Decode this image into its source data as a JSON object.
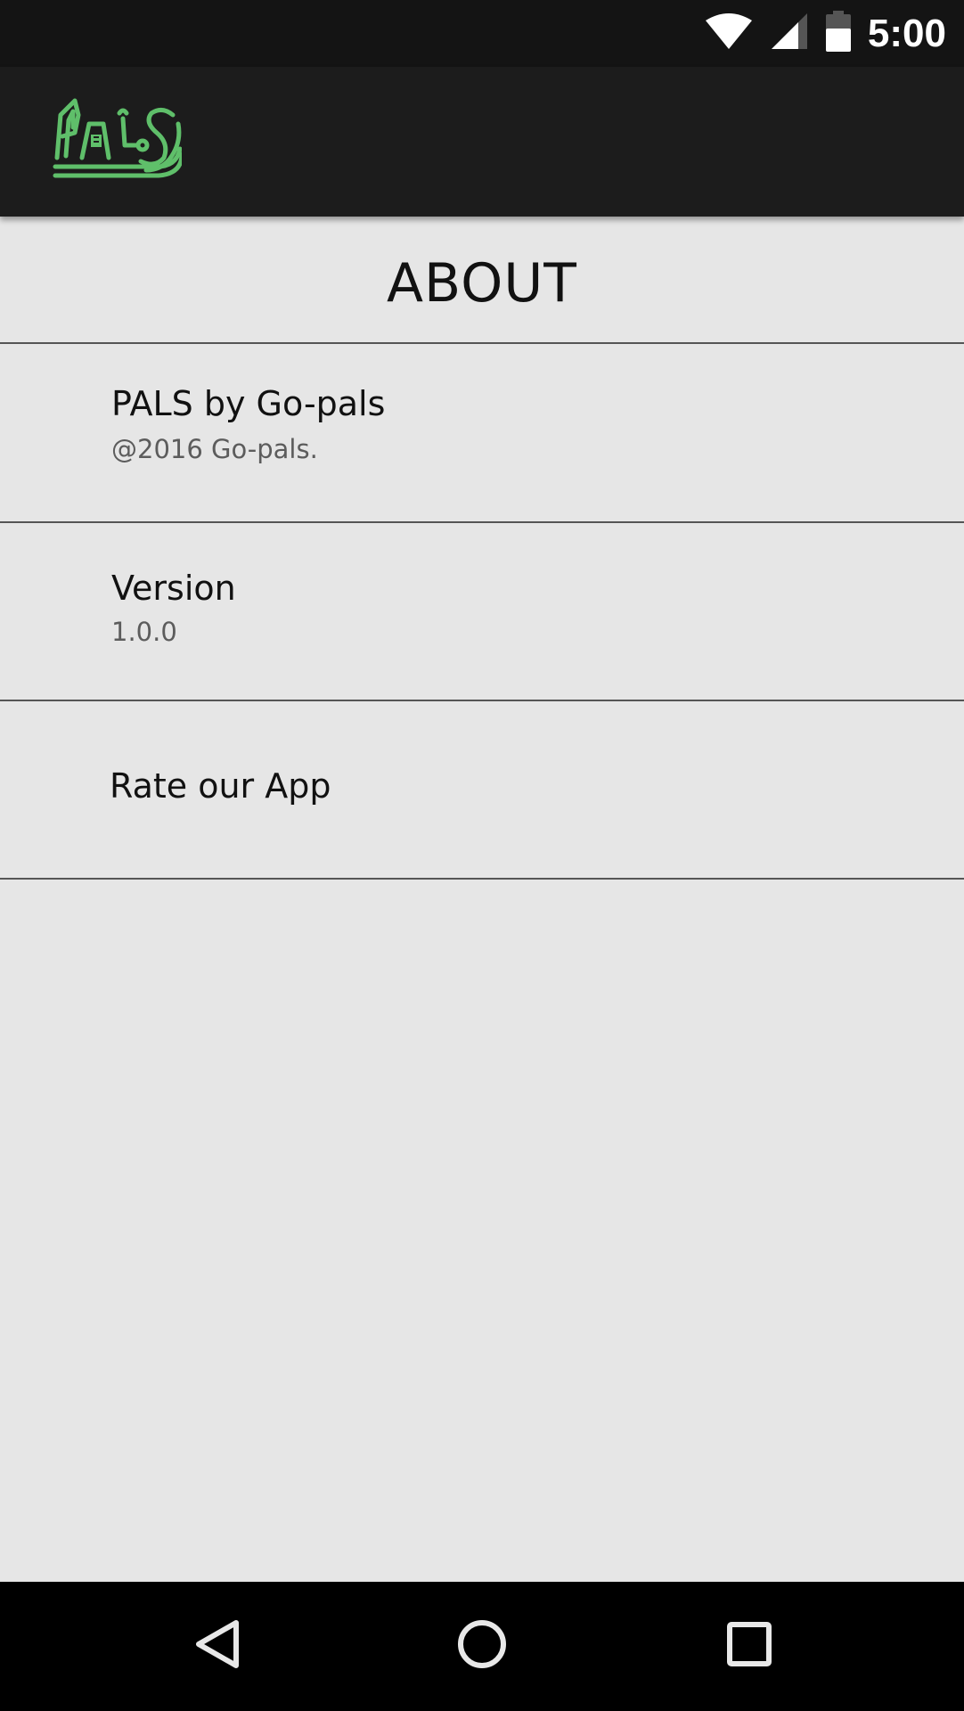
{
  "status_bar": {
    "time": "5:00",
    "icons": [
      "wifi-icon",
      "cellular-signal-icon",
      "battery-icon"
    ]
  },
  "app_bar": {
    "logo_text": "PALS",
    "logo_color": "#5fbf6a"
  },
  "page": {
    "title": "ABOUT"
  },
  "rows": [
    {
      "title": "PALS by Go-pals",
      "subtitle": "@2016 Go-pals."
    },
    {
      "title": "Version",
      "subtitle": "1.0.0"
    },
    {
      "title": "Rate our App"
    }
  ],
  "nav_bar": {
    "icons": [
      "back-icon",
      "home-icon",
      "recents-icon"
    ]
  },
  "colors": {
    "status_bar_bg": "#141414",
    "app_bar_bg": "#1c1c1c",
    "content_bg": "#e6e6e6",
    "nav_bar_bg": "#000000",
    "accent": "#5fbf6a"
  }
}
